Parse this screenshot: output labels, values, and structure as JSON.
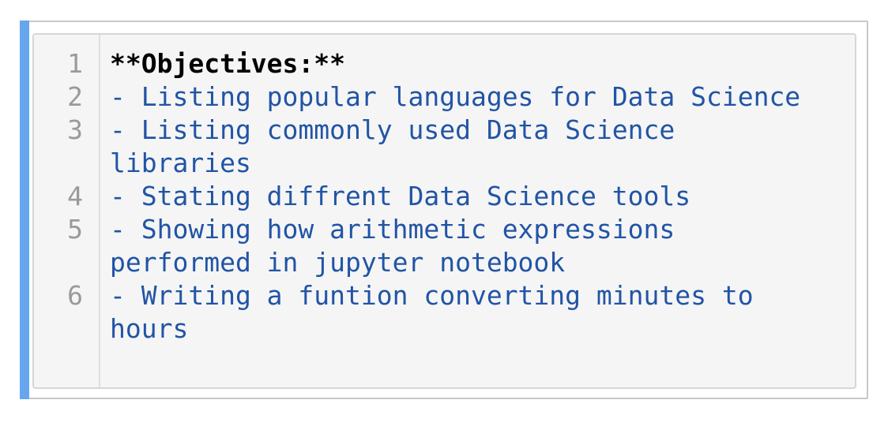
{
  "notebook_cell": {
    "type": "markdown",
    "lines": [
      {
        "number": "1",
        "text": "**Objectives:**",
        "style": "heading"
      },
      {
        "number": "2",
        "text": "- Listing popular languages for Data Science",
        "style": "list"
      },
      {
        "number": "3",
        "text": "- Listing commonly used Data Science libraries",
        "style": "list"
      },
      {
        "number": "4",
        "text": "- Stating diffrent Data Science tools",
        "style": "list"
      },
      {
        "number": "5",
        "text": "- Showing how arithmetic expressions performed in jupyter notebook",
        "style": "list"
      },
      {
        "number": "6",
        "text": "- Writing a funtion converting minutes to hours",
        "style": "list"
      }
    ]
  },
  "colors": {
    "accent_bar": "#66a6ee",
    "list_text": "#2154a5",
    "heading_text": "#000000",
    "line_number": "#9a9a9a",
    "editor_bg": "#f5f5f5"
  }
}
